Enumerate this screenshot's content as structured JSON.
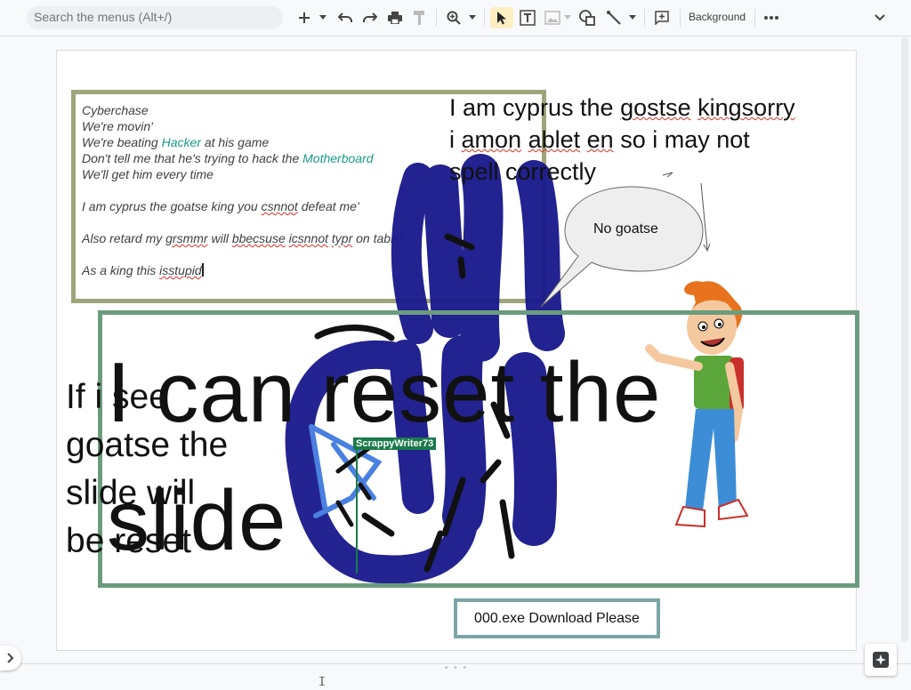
{
  "toolbar": {
    "search_placeholder": "Search the menus (Alt+/)",
    "background_label": "Background",
    "active_color": "#feefc3"
  },
  "slide": {
    "poem_lines": [
      {
        "parts": [
          "Cyberchase"
        ]
      },
      {
        "parts": [
          "We're movin'"
        ]
      },
      {
        "parts": [
          "We're beating ",
          "Hacker",
          " at his game"
        ]
      },
      {
        "parts": [
          "Don't tell me that he's trying to hack the ",
          "Motherboard"
        ]
      },
      {
        "parts": [
          "We'll get him every time"
        ]
      }
    ],
    "poem_line_a1": "Cyberchase",
    "poem_line_a2": "We're movin'",
    "poem_line_a3_pre": "We're beating ",
    "poem_line_a3_link": "Hacker",
    "poem_line_a3_post": " at his game",
    "poem_line_a4_pre": "Don't tell me that he's trying to hack the ",
    "poem_line_a4_link": "Motherboard",
    "poem_line_a5": "We'll get him every time",
    "poem_line_b_pre": "I am cyprus the goatse king you ",
    "poem_line_b_sq": "csnnot",
    "poem_line_b_post": " defeat me’",
    "poem_line_c_pre": "Also retard my ",
    "poem_line_c_sq1": "grsmmr",
    "poem_line_c_mid1": " will ",
    "poem_line_c_sq2": "bbecsuse",
    "poem_line_c_mid2": " ",
    "poem_line_c_sq3": "icsnnot",
    "poem_line_c_mid3": " ",
    "poem_line_c_sq4": "typr",
    "poem_line_c_post": " on tablet",
    "poem_line_d_pre": "As a king this ",
    "poem_line_d_sq": "isstupid",
    "cyprus_l1_pre": "I am cyprus the ",
    "cyprus_l1_sq": "gostse",
    "cyprus_l1_mid": " ",
    "cyprus_l1_sq2": "kingsorry",
    "cyprus_l2_pre": "i ",
    "cyprus_l2_sq": "amon",
    "cyprus_l2_mid": " ",
    "cyprus_l2_sq2": "ablet",
    "cyprus_l2_mid2": " ",
    "cyprus_l2_sq3": "en",
    "cyprus_l2_post": " so i may not",
    "cyprus_l3": "spell correctly",
    "bubble": "No goatse",
    "huge_line1": "I can reset the",
    "huge_line2": "slide",
    "left_l1": "If i see",
    "left_l2": "goatse the",
    "left_l3": "slide will",
    "left_l4": "be reset",
    "cursor_user": "ScrappyWriter73",
    "download_button": "000.exe Download Please"
  },
  "colors": {
    "poem_border": "#a0a47a",
    "green_border": "#6b9c7d",
    "scribble": "#1a1a8c",
    "teal_link": "#1a9a87",
    "download_border": "#7ca5a6"
  }
}
